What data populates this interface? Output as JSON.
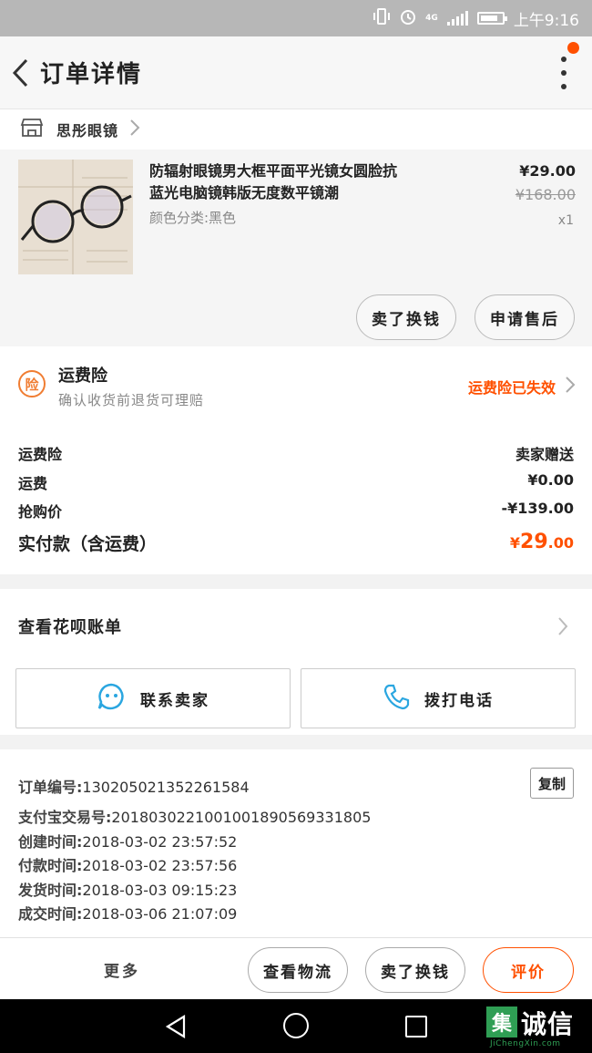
{
  "status_bar": {
    "time": "上午9:16",
    "network": "4G"
  },
  "header": {
    "title": "订单详情"
  },
  "shop": {
    "name": "思彤眼镜"
  },
  "product": {
    "title_line1": "防辐射眼镜男大框平面平光镜女圆脸抗",
    "title_line2": "蓝光电脑镜韩版无度数平镜潮",
    "sku": "颜色分类:黑色",
    "price": "¥29.00",
    "original_price": "¥168.00",
    "quantity": "x1",
    "buttons": {
      "refund": "卖了换钱",
      "after_sale": "申请售后"
    }
  },
  "insurance": {
    "badge": "险",
    "title": "运费险",
    "subtitle": "确认收货前退货可理赔",
    "status": "运费险已失效"
  },
  "summary": {
    "rows": [
      {
        "label": "运费险",
        "value": "卖家赠送"
      },
      {
        "label": "运费",
        "value": "¥0.00"
      },
      {
        "label": "抢购价",
        "value": "-¥139.00"
      }
    ],
    "total_label": "实付款（含运费）",
    "total_currency": "¥",
    "total_integer": "29",
    "total_decimal": ".00"
  },
  "huabei": {
    "label": "查看花呗账单"
  },
  "contact": {
    "seller": "联系卖家",
    "phone": "拨打电话"
  },
  "order_info": {
    "copy_label": "复制",
    "lines": [
      {
        "k": "订单编号:",
        "v": "130205021352261584"
      },
      {
        "k": "支付宝交易号:",
        "v": "2018030221001001890569331805"
      },
      {
        "k": "创建时间:",
        "v": "2018-03-02 23:57:52"
      },
      {
        "k": "付款时间:",
        "v": "2018-03-02 23:57:56"
      },
      {
        "k": "发货时间:",
        "v": "2018-03-03 09:15:23"
      },
      {
        "k": "成交时间:",
        "v": "2018-03-06 21:07:09"
      }
    ]
  },
  "bottom_bar": {
    "more": "更多",
    "logistics": "查看物流",
    "refund": "卖了换钱",
    "review": "评价"
  },
  "watermark": {
    "box": "集",
    "text": "诚信",
    "url": "JiChengXin.com"
  },
  "colors": {
    "accent": "#ff5000",
    "insurance": "#f07d32",
    "watermark": "#2f9e54"
  }
}
